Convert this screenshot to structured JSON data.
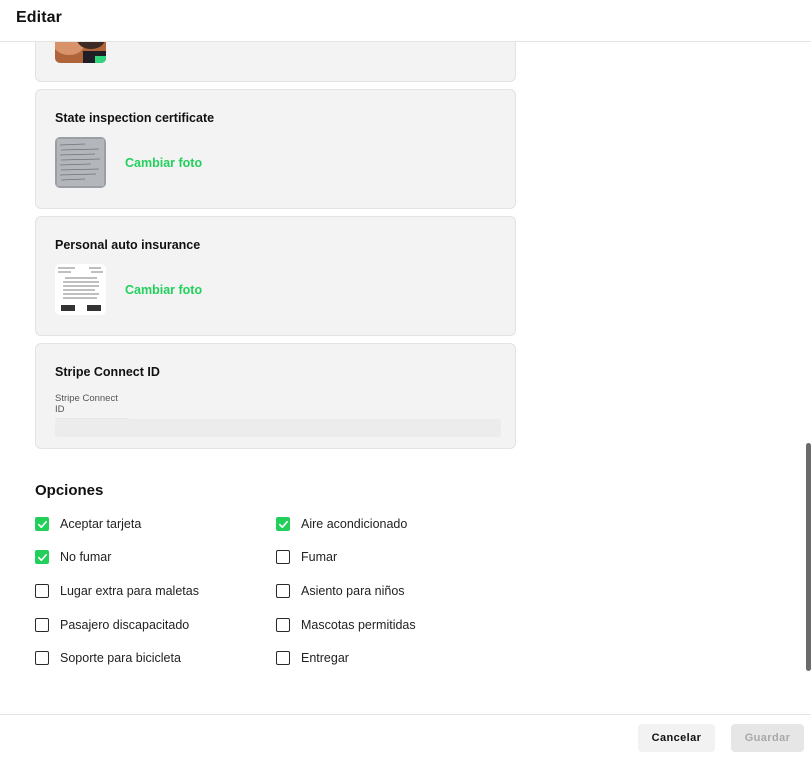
{
  "header": {
    "title": "Editar"
  },
  "cards": [
    {
      "title": "State inspection certificate",
      "action": "Cambiar foto"
    },
    {
      "title": "Personal auto insurance",
      "action": "Cambiar foto"
    }
  ],
  "stripe": {
    "title": "Stripe Connect ID",
    "field_label": "Stripe Connect ID",
    "value": ""
  },
  "options": {
    "title": "Opciones",
    "left": [
      {
        "label": "Aceptar tarjeta",
        "checked": true
      },
      {
        "label": "No fumar",
        "checked": true
      },
      {
        "label": "Lugar extra para maletas",
        "checked": false
      },
      {
        "label": "Pasajero discapacitado",
        "checked": false
      },
      {
        "label": "Soporte para bicicleta",
        "checked": false
      }
    ],
    "right": [
      {
        "label": "Aire acondicionado",
        "checked": true
      },
      {
        "label": "Fumar",
        "checked": false
      },
      {
        "label": "Asiento para niños",
        "checked": false
      },
      {
        "label": "Mascotas permitidas",
        "checked": false
      },
      {
        "label": "Entregar",
        "checked": false
      }
    ]
  },
  "footer": {
    "cancel_label": "Cancelar",
    "save_label": "Guardar"
  },
  "colors": {
    "accent": "#22d05c",
    "checkbox_on": "#22cf5b"
  }
}
